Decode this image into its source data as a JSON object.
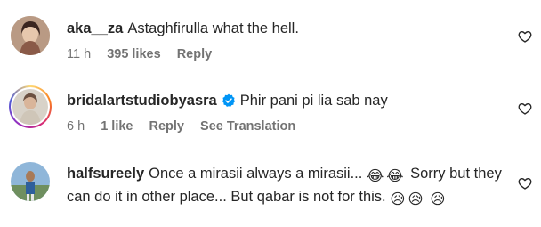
{
  "comments": [
    {
      "username": "aka__za",
      "text": "Astaghfirulla what the hell.",
      "time": "11 h",
      "likes": "395 likes",
      "reply": "Reply",
      "verified": false,
      "heart_icon": "heart-outline-icon"
    },
    {
      "username": "bridalartstudiobyasra",
      "text": "Phir pani pi lia sab nay",
      "time": "6 h",
      "likes": "1 like",
      "reply": "Reply",
      "see_translation": "See Translation",
      "verified": true,
      "heart_icon": "heart-outline-icon"
    },
    {
      "username": "halfsureely",
      "text_part1": "Once a mirasii always a mirasii...",
      "text_part2": "Sorry but they can do it in other place... But qabar is not for this.",
      "emojis": [
        "😂",
        "😂",
        "😥",
        "😥",
        "😥"
      ],
      "verified": false,
      "heart_icon": "heart-outline-icon"
    }
  ],
  "colors": {
    "text": "#262626",
    "secondary": "#737373",
    "verified": "#0095f6"
  }
}
